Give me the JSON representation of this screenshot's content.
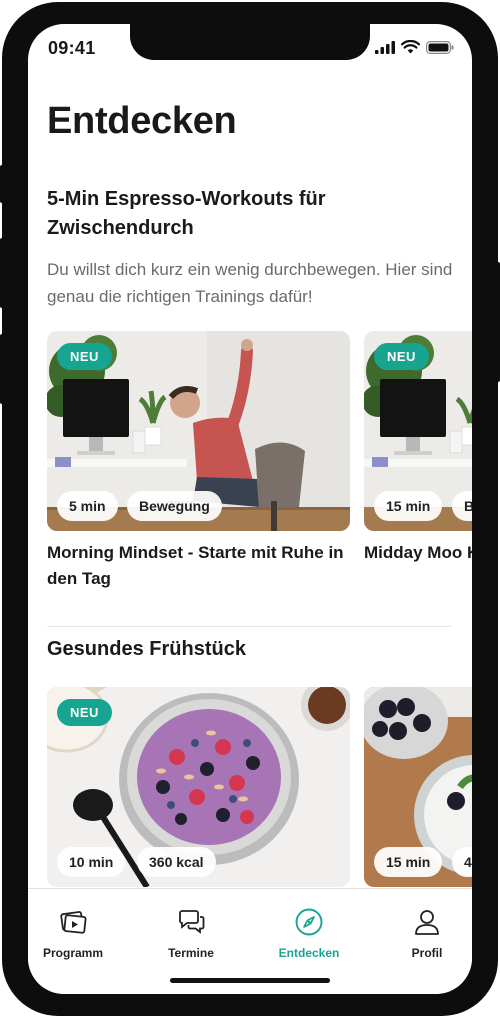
{
  "status": {
    "time": "09:41"
  },
  "page": {
    "title": "Entdecken"
  },
  "sections": [
    {
      "title": "5-Min Espresso-Workouts für Zwischendurch",
      "description": "Du willst dich kurz ein wenig durchbewegen. Hier sind genau die richtigen Trainings dafür!",
      "cards": [
        {
          "badge": "NEU",
          "chips": [
            "5 min",
            "Bewegung"
          ],
          "title": "Morning Mindset - Starte mit Ruhe in den Tag"
        },
        {
          "badge": "NEU",
          "chips": [
            "15 min",
            "B"
          ],
          "title": "Midday Moo Körper und G"
        }
      ]
    },
    {
      "title": "Gesundes Frühstück",
      "cards": [
        {
          "badge": "NEU",
          "chips": [
            "10 min",
            "360 kcal"
          ]
        },
        {
          "chips": [
            "15 min",
            "4"
          ]
        }
      ]
    }
  ],
  "tabbar": {
    "items": [
      {
        "label": "Programm",
        "icon": "program-icon"
      },
      {
        "label": "Termine",
        "icon": "chat-icon"
      },
      {
        "label": "Entdecken",
        "icon": "compass-icon",
        "active": true
      },
      {
        "label": "Profil",
        "icon": "person-icon"
      }
    ]
  },
  "colors": {
    "accent": "#17a592",
    "text": "#1a1a1a",
    "muted": "#6b6b6b"
  }
}
